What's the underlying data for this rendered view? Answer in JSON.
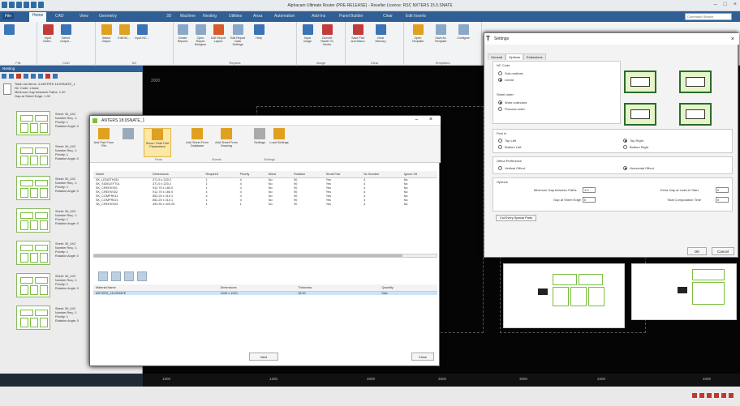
{
  "app": {
    "title": "Alphacam Ultimate Router (PRE-RELEASE) - Reseller Licence: RSC NXTERS 15.0.SNATE",
    "search_placeholder": "Command Search"
  },
  "menu": {
    "tabs": [
      "File",
      "Home",
      "CAD",
      "View",
      "Geometry",
      "3D",
      "Machine",
      "Nesting",
      "Utilities",
      "Ansa",
      "Automation",
      "Add-Ins",
      "Panel Builder",
      "Clear",
      "Edit Inserts"
    ]
  },
  "ribbon": {
    "buttons": [
      {
        "label": "Input Cutter..."
      },
      {
        "label": "Select Output..."
      },
      {
        "label": "Select Output"
      },
      {
        "label": "Edit NC..."
      },
      {
        "label": "Input NC..."
      },
      {
        "label": "Create Reports"
      },
      {
        "label": "Open Report Designer"
      },
      {
        "label": "Edit Report Layout"
      },
      {
        "label": "Edit Report Data Settings"
      },
      {
        "label": "Help"
      },
      {
        "label": "Input Image"
      },
      {
        "label": "Convert Raster To Vector"
      },
      {
        "label": "Save Part and Macro"
      },
      {
        "label": "Clear Memory"
      },
      {
        "label": "Open Template"
      },
      {
        "label": "Save As Template"
      },
      {
        "label": "Configure"
      }
    ],
    "groups": [
      "File",
      "CAD",
      "NC",
      "Reports",
      "Image",
      "Clear",
      "Templates"
    ]
  },
  "leftpanel": {
    "header": "Nesting",
    "nc_lines": [
      "Total List Items: 4 ANTERS 18.0SNATE_1",
      "NC Code: Linear",
      "Minimum Gap between Paths: 1.00",
      "Gap at Sheet Edge: 1.00"
    ],
    "sheets": [
      {
        "meta": [
          "Sheet: 30_4X2",
          "Number Req.: 1",
          "Priority: 1",
          "Rotation Angle: 0"
        ]
      },
      {
        "meta": [
          "Sheet: 30_4X2",
          "Number Req.: 1",
          "Priority: 1",
          "Rotation Angle: 0"
        ]
      },
      {
        "meta": [
          "Sheet: 30_4X2",
          "Number Req.: 1",
          "Priority: 1",
          "Rotation Angle: 0"
        ]
      },
      {
        "meta": [
          "Sheet: 30_4X2",
          "Number Req.: 1",
          "Priority: 1",
          "Rotation Angle: 0"
        ]
      },
      {
        "meta": [
          "Sheet: 30_4X2",
          "Number Req.: 1",
          "Priority: 1",
          "Rotation Angle: 0"
        ]
      },
      {
        "meta": [
          "Sheet: 30_4X2",
          "Number Req.: 1",
          "Priority: 1",
          "Rotation Angle: 0"
        ]
      },
      {
        "meta": [
          "Sheet: 30_4X2",
          "Number Req.: 1",
          "Priority: 1",
          "Rotation Angle: 0"
        ]
      }
    ]
  },
  "canvas": {
    "label": "2000",
    "ruler": [
      "1000",
      "1200",
      "2000",
      "2600",
      "3000",
      "3400",
      "4000"
    ]
  },
  "nesting_dialog": {
    "title": "ANTERS 18.0SNATE_1",
    "buttons": [
      "Add Part From File",
      "",
      "Show / Hide Part Parameters",
      "Add Sheet From Database",
      "Add Sheet From Drawing",
      "Settings",
      "Load Settings"
    ],
    "groups": [
      "Parts",
      "Sheets",
      "Settings"
    ],
    "parts_columns": [
      "Name",
      "Dimensions",
      "Required",
      "Priority",
      "Mirror",
      "Rotation",
      "Small Part",
      "Nc Number",
      "Ignore Oll"
    ],
    "parts_rows": [
      [
        "SK_LENGTH011",
        "371.5 x 220.2",
        "1",
        "4",
        "No",
        "90",
        "Yes",
        "4",
        "No"
      ],
      [
        "SK_SIDELEFT01",
        "371.5 x 220.2",
        "1",
        "4",
        "No",
        "90",
        "Yes",
        "4",
        "No"
      ],
      [
        "SK_CREEKS01",
        "912.75 x 180.0",
        "1",
        "4",
        "No",
        "90",
        "Yes",
        "4",
        "No"
      ],
      [
        "SK_CREEKS02",
        "912.75 x 180.0",
        "4",
        "4",
        "No",
        "90",
        "Yes",
        "4",
        "No"
      ],
      [
        "SK_COMPR011",
        "852.25 x 410.1",
        "4",
        "4",
        "No",
        "90",
        "Yes",
        "4",
        "No"
      ],
      [
        "SK_COMPR021",
        "852.25 x 410.1",
        "1",
        "4",
        "No",
        "90",
        "Yes",
        "4",
        "No"
      ],
      [
        "SK_CREEKS03",
        "490.35 x 400.25",
        "1",
        "1",
        "No",
        "90",
        "Yes",
        "4",
        "No"
      ]
    ],
    "sheets_columns": [
      "Material Name",
      "Dimensions",
      "Thickness",
      "",
      "Quantity"
    ],
    "sheets_rows": [
      [
        "ANTERS_18.0SNATE",
        "2440 x 1220",
        "18.00",
        "",
        "Max"
      ]
    ],
    "nest_button": "Nest",
    "close_button": "Close"
  },
  "settings_dialog": {
    "title": "Settings",
    "tabs": [
      "General",
      "Options",
      "Extensions"
    ],
    "nc_code_label": "NC Code",
    "nc_code_options": [
      {
        "label": "Sub-routines",
        "on": false
      },
      {
        "label": "Linear",
        "on": true
      }
    ],
    "sheet_order_label": "Sheet order",
    "sheet_order_options": [
      {
        "label": "Work collectors",
        "on": true
      },
      {
        "label": "Process order",
        "on": false
      }
    ],
    "first_in_label": "First in",
    "first_in_options": [
      {
        "label": "Top Left",
        "on": false
      },
      {
        "label": "Top Right",
        "on": true
      },
      {
        "label": "Bottom Left",
        "on": false
      },
      {
        "label": "Bottom Right",
        "on": false
      }
    ],
    "offcut_label": "Offcut Preference",
    "offcut_options": [
      {
        "label": "Vertical Offcut",
        "on": false
      },
      {
        "label": "Horizontal Offcut",
        "on": true
      }
    ],
    "options_label": "Options",
    "min_gap_label": "Minimum Gap between Paths",
    "min_gap_value": "1.0",
    "gap_edge_label": "Gap at Sheet Edge",
    "gap_edge_value": "0",
    "extra_gap_label": "Extra Gap at Lead-In Start",
    "extra_gap_value": "0",
    "total_time_label": "Total Computation Time",
    "total_time_value": "0",
    "special_parts_label": "Cut Every Special Parts",
    "ok": "OK",
    "cancel": "Cancel"
  }
}
